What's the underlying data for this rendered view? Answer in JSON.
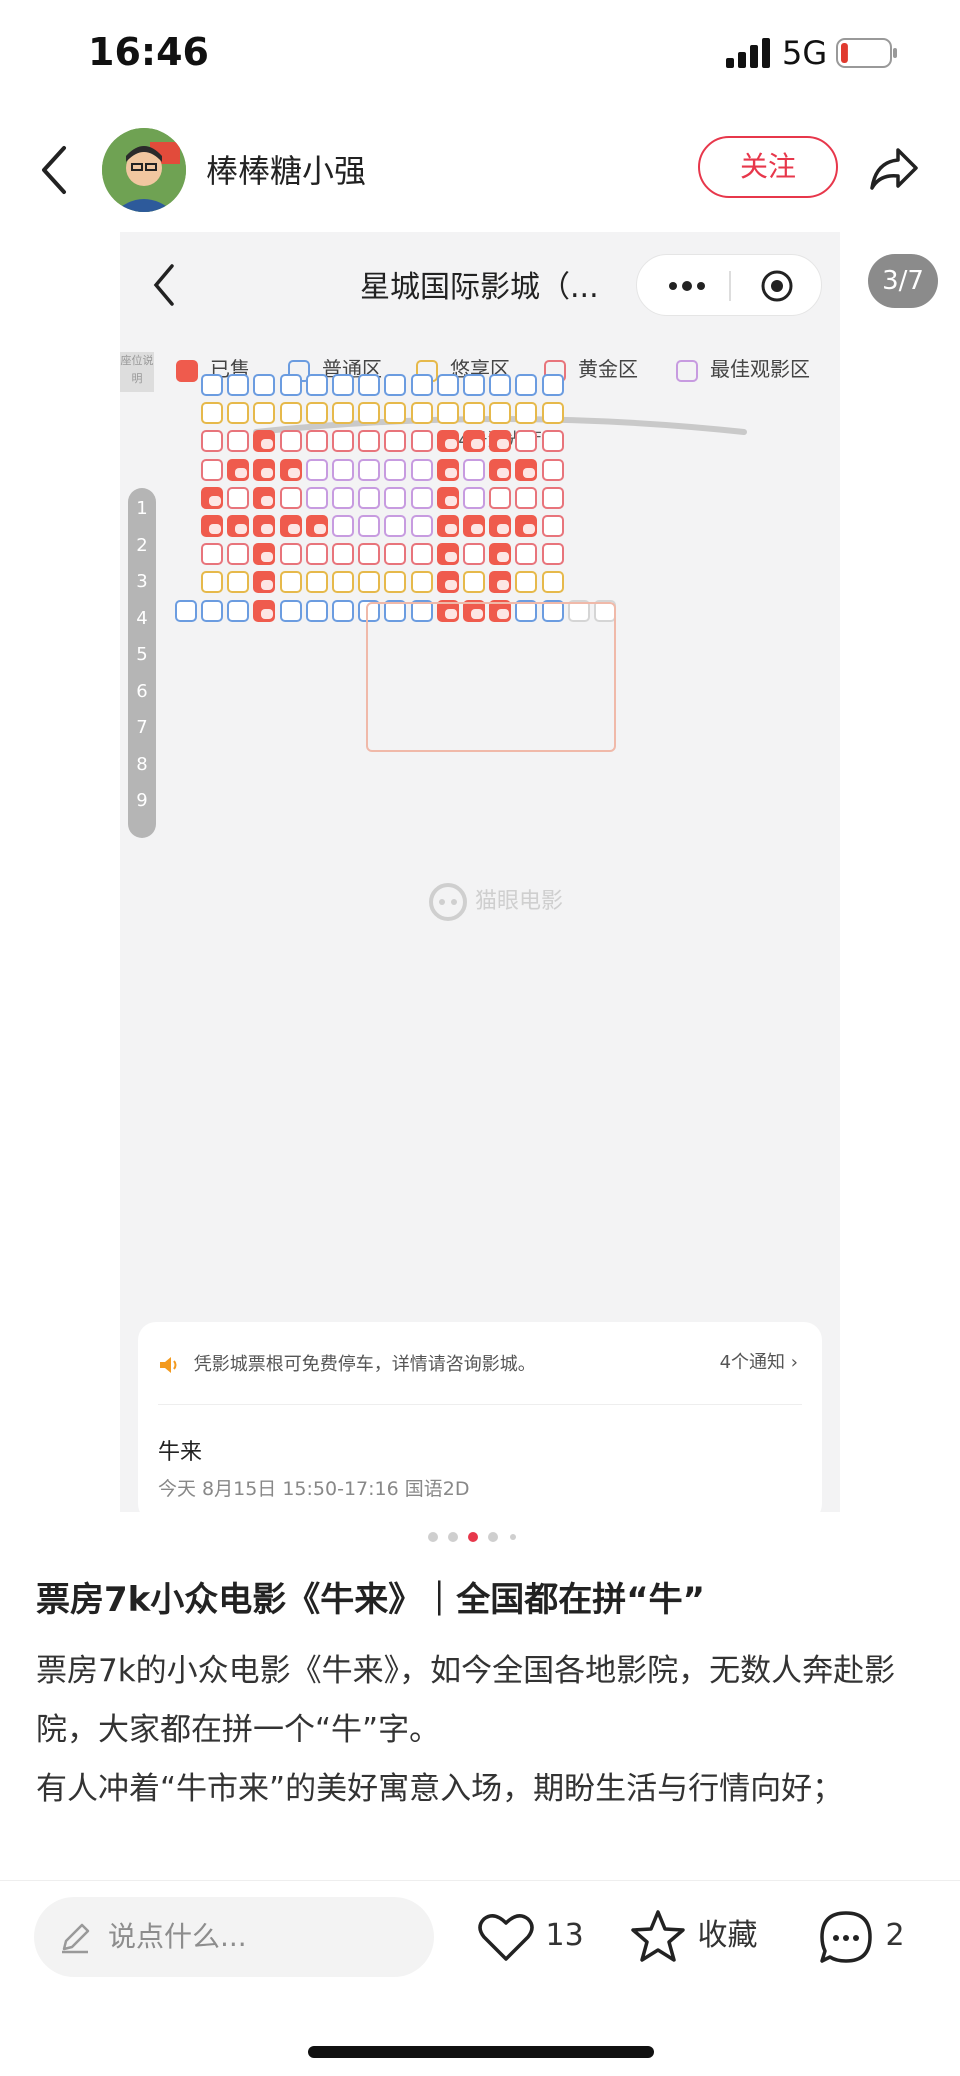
{
  "status": {
    "time": "16:46",
    "network": "5G",
    "battery_level": 0.15
  },
  "header": {
    "username": "棒棒糖小强",
    "follow": "关注"
  },
  "image_pager": {
    "label": "3/7",
    "current": 3,
    "total": 7,
    "dot_count": 5,
    "active_dot": 2
  },
  "inner_app": {
    "title": "星城国际影城（...",
    "seat_note": "座位说明",
    "legend": [
      {
        "label": "已售",
        "color": "#ef5b4d"
      },
      {
        "label": "普通区",
        "color": "#6b9ce0"
      },
      {
        "label": "悠享区",
        "color": "#e6b94b"
      },
      {
        "label": "黄金区",
        "color": "#e8747b"
      },
      {
        "label": "最佳观影区",
        "color": "#c79be0"
      }
    ],
    "hall": "4号激光厅",
    "rows": [
      "1",
      "2",
      "3",
      "4",
      "5",
      "6",
      "7",
      "8",
      "9"
    ],
    "watermark": "猫眼电影",
    "notice": "凭影城票根可免费停车，详情请咨询影城。",
    "notice_count": "4个通知",
    "movie": "牛来",
    "showtime": "今天  8月15日 15:50-17:16 国语2D"
  },
  "post": {
    "title": "票房7k小众电影《牛来》｜全国都在拼“牛”",
    "body": "票房7k的小众电影《牛来》，如今全国各地影院，无数人奔赴影院，大家都在拼一个“牛”字。\n有人冲着“牛市来”的美好寓意入场，期盼生活与行情向好；"
  },
  "bottom": {
    "comment_placeholder": "说点什么...",
    "likes": "13",
    "collect": "收藏",
    "comments": "2"
  }
}
